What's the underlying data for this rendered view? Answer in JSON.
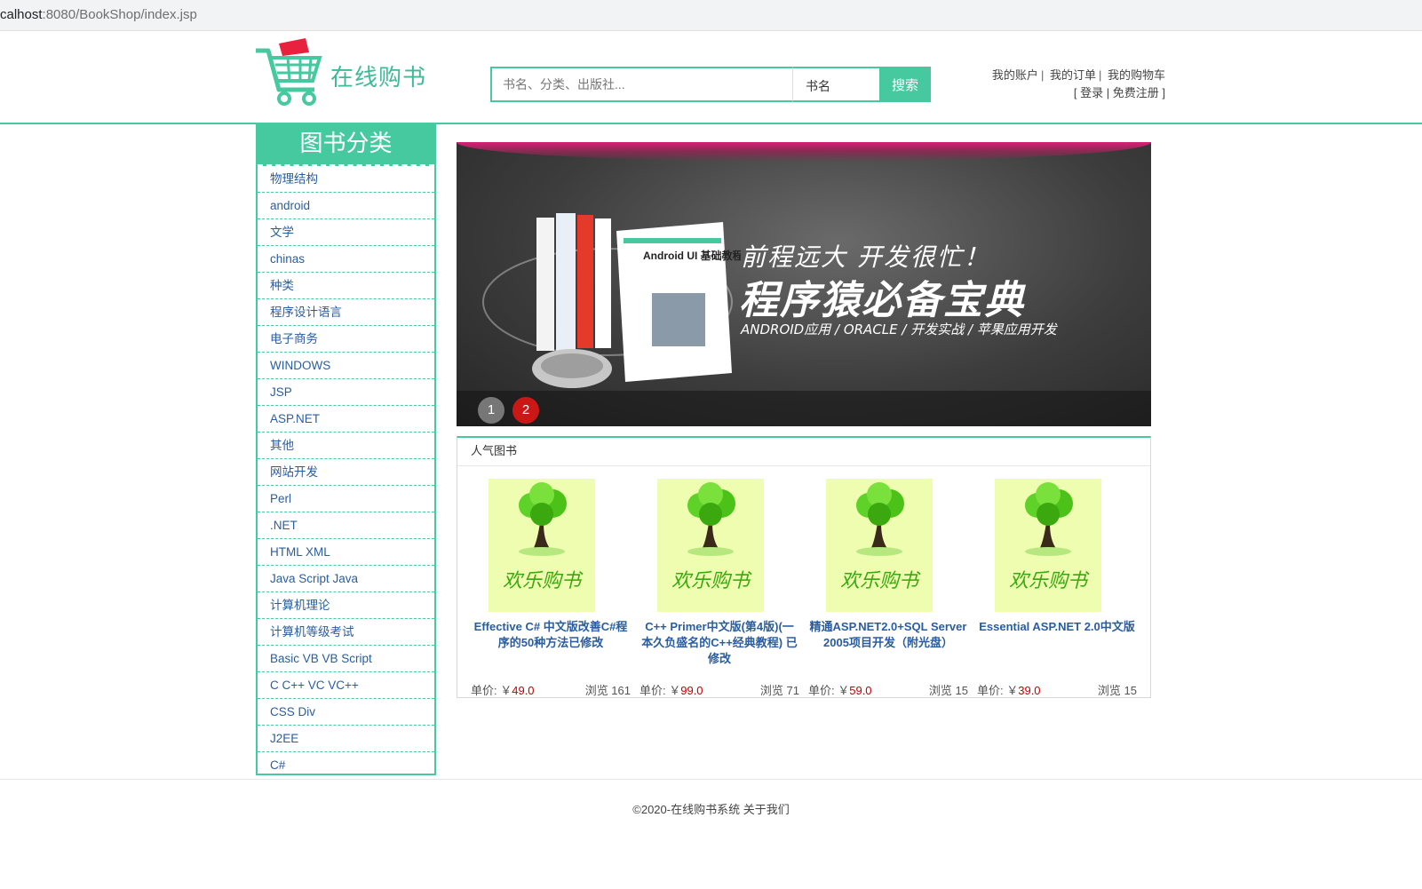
{
  "address_bar": {
    "url_host": "calhost",
    "url_rest": ":8080/BookShop/index.jsp"
  },
  "header": {
    "logo_text": "在线购书",
    "search_placeholder": "书名、分类、出版社...",
    "search_type_selected": "书名",
    "search_button": "搜索",
    "account_links": [
      "我的账户",
      "我的订单",
      "我的购物车"
    ],
    "login": "登录",
    "register": "免费注册",
    "bracket_open": "[",
    "bracket_close": "]",
    "sep": "|"
  },
  "sidebar": {
    "title": "图书分类",
    "items": [
      "物理结构",
      "android",
      "文学",
      "chinas",
      "种类",
      "程序设计语言",
      "电子商务",
      "WINDOWS",
      "JSP",
      "ASP.NET",
      "其他",
      "网站开发",
      "Perl",
      ".NET",
      "HTML XML",
      "Java Script Java",
      "计算机理论",
      "计算机等级考试",
      "Basic VB VB Script",
      "C C++ VC VC++",
      "CSS Div",
      "J2EE",
      "C#"
    ]
  },
  "banner": {
    "line1": "前程远大 开发很忙！",
    "line2": "程序猿必备宝典",
    "line3": "ANDROID应用 / ORACLE / 开发实战 / 苹果应用开发",
    "book_title": "Android UI 基础教程",
    "slides": [
      "1",
      "2"
    ],
    "active_slide": 2
  },
  "popular": {
    "title": "人气图书",
    "cover_text": "欢乐购书",
    "books": [
      {
        "title": "Effective C# 中文版改善C#程序的50种方法已修改",
        "price_label": "单价: ￥",
        "price": "49.0",
        "views": "浏览 161"
      },
      {
        "title": "C++ Primer中文版(第4版)(一本久负盛名的C++经典教程) 已修改",
        "price_label": "单价: ￥",
        "price": "99.0",
        "views": "浏览 71"
      },
      {
        "title": "精通ASP.NET2.0+SQL Server 2005项目开发（附光盘）",
        "price_label": "单价: ￥",
        "price": "59.0",
        "views": "浏览 15"
      },
      {
        "title": "Essential ASP.NET 2.0中文版",
        "price_label": "单价: ￥",
        "price": "39.0",
        "views": "浏览 15"
      }
    ]
  },
  "footer": {
    "text": "©2020-在线购书系统 关于我们"
  },
  "colors": {
    "accent": "#47c9a0",
    "link": "#2a5d9f",
    "price": "#c40000",
    "banner_pink": "#d91f78"
  }
}
